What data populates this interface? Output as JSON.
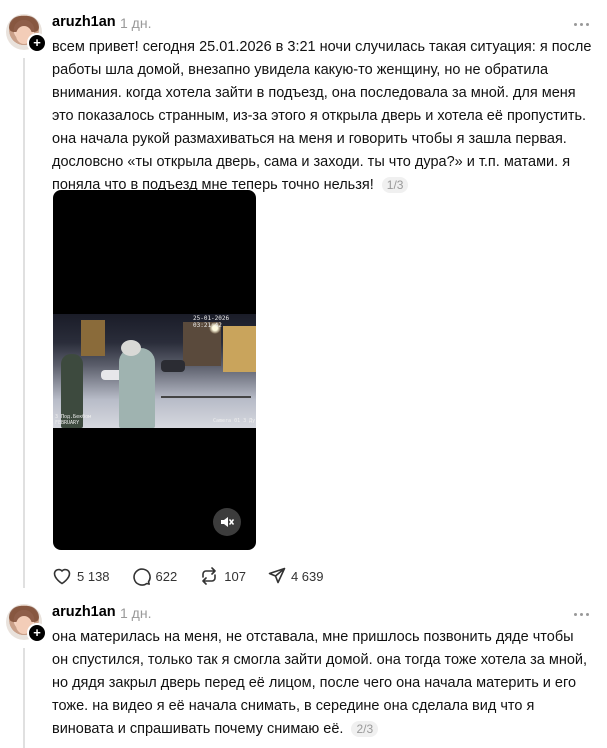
{
  "posts": [
    {
      "username": "aruzh1an",
      "time": "1 дн.",
      "text": "всем привет! сегодня 25.01.2026 в 3:21 ночи случилась такая ситуация: я после работы шла домой, внезапно увидела какую-то женщину, но не обратила внимания. когда хотела зайти в подъезд, она последовала за мной. для меня это показалось странным, из-за этого я открыла дверь и хотела её пропустить. она начала рукой размахиваться на меня и говорить чтобы я зашла первая. дословсно «ты открыла дверь, сама и заходи. ты что дура?» и т.п. матами. я поняла что в подъезд мне теперь точно нельзя!",
      "counter": "1/3",
      "stats": {
        "likes": "5 138",
        "replies": "622",
        "reposts": "107",
        "shares": "4 639"
      },
      "video": {
        "stamp_top": "25-01-2026 03:21:42",
        "stamp_left": "3 Под.Бекбом\nFEBRUARY",
        "stamp_right": "Camera 01 3 Ду"
      }
    },
    {
      "username": "aruzh1an",
      "time": "1 дн.",
      "text": "она материлась на меня, не отставала, мне пришлось позвонить дяде чтобы он спустился, только так я смогла зайти домой. она тогда тоже хотела за мной, но дядя закрыл дверь перед её лицом, после чего она начала материть и его тоже. на видео я её начала снимать, в середине она сделала вид что я виновата и спрашивать почему снимаю её.",
      "counter": "2/3"
    }
  ],
  "colors": {
    "muted": "#999999",
    "accent": "#000000",
    "line": "#e0e0e0"
  },
  "icons": [
    "heart-icon",
    "comment-icon",
    "repost-icon",
    "share-icon",
    "more-icon",
    "mute-icon",
    "plus-icon"
  ]
}
